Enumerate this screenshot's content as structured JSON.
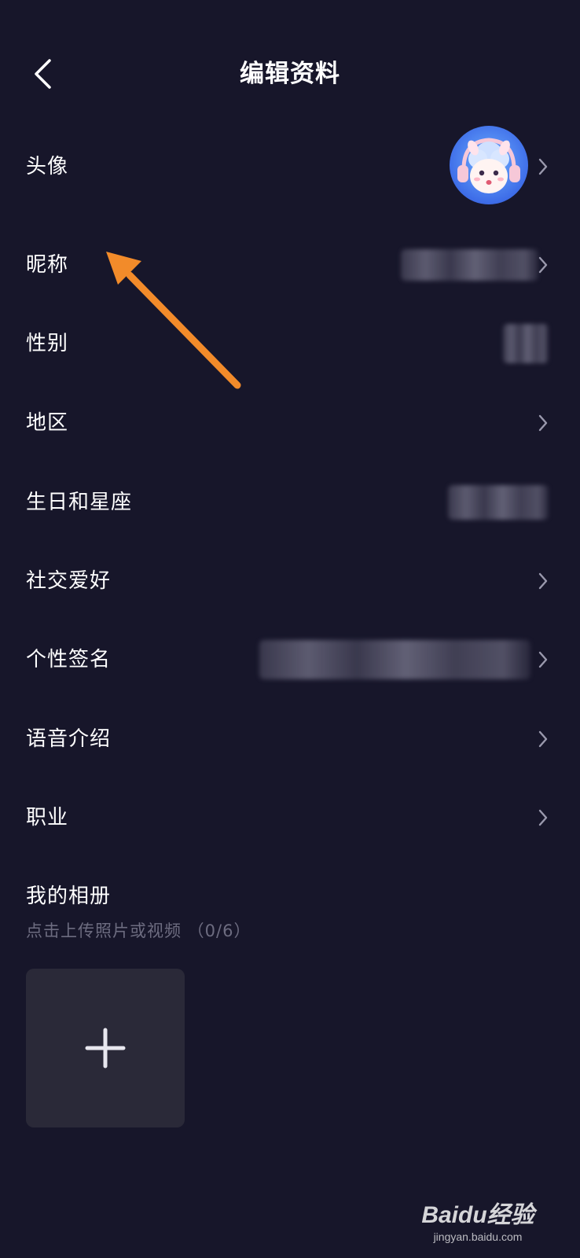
{
  "header": {
    "title": "编辑资料",
    "back_icon": "chevron-left-icon"
  },
  "rows": [
    {
      "key": "avatar",
      "label": "头像"
    },
    {
      "key": "nickname",
      "label": "昵称"
    },
    {
      "key": "gender",
      "label": "性别"
    },
    {
      "key": "region",
      "label": "地区"
    },
    {
      "key": "birthday",
      "label": "生日和星座"
    },
    {
      "key": "hobbies",
      "label": "社交爱好"
    },
    {
      "key": "signature",
      "label": "个性签名"
    },
    {
      "key": "voice",
      "label": "语音介绍"
    },
    {
      "key": "job",
      "label": "职业"
    }
  ],
  "album": {
    "title": "我的相册",
    "hint": "点击上传照片或视频 （0/6）",
    "add_icon": "plus-icon"
  },
  "watermark": {
    "brand": "Baidu经验",
    "url": "jingyan.baidu.com"
  },
  "colors": {
    "background": "#17162a",
    "annotation_arrow": "#f28b2a",
    "tile": "#2a2938",
    "hint_text": "#6d6c80"
  }
}
